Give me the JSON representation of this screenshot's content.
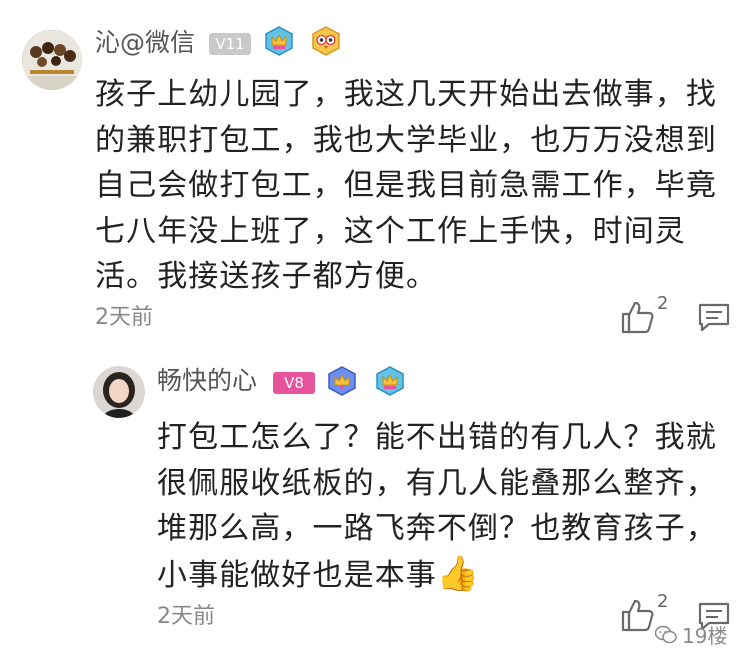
{
  "comments": [
    {
      "username": "沁@微信",
      "level": "V11",
      "text": "孩子上幼儿园了，我这几天开始出去做事，找的兼职打包工，我也大学毕业，也万万没想到自己会做打包工，但是我目前急需工作，毕竟七八年没上班了，这个工作上手快，时间灵活。我接送孩子都方便。",
      "time": "2天前",
      "likes": "2"
    },
    {
      "username": "畅快的心",
      "level": "V8",
      "text": "打包工怎么了？能不出错的有几人？我就很佩服收纸板的，有几人能叠那么整齐，堆那么高，一路飞奔不倒？也教育孩子，小事能做好也是本事",
      "emoji": "👍",
      "time": "2天前",
      "likes": "2"
    }
  ],
  "watermark": "19楼",
  "colors": {
    "level_gray": "#c9c9c9",
    "level_pink": "#e8549c",
    "text": "#222222",
    "meta": "#888888",
    "icon": "#6a6a6a"
  },
  "icons": [
    "avatar",
    "badge-crown-icon",
    "badge-owl-icon",
    "like-icon",
    "reply-icon",
    "wechat-icon"
  ]
}
